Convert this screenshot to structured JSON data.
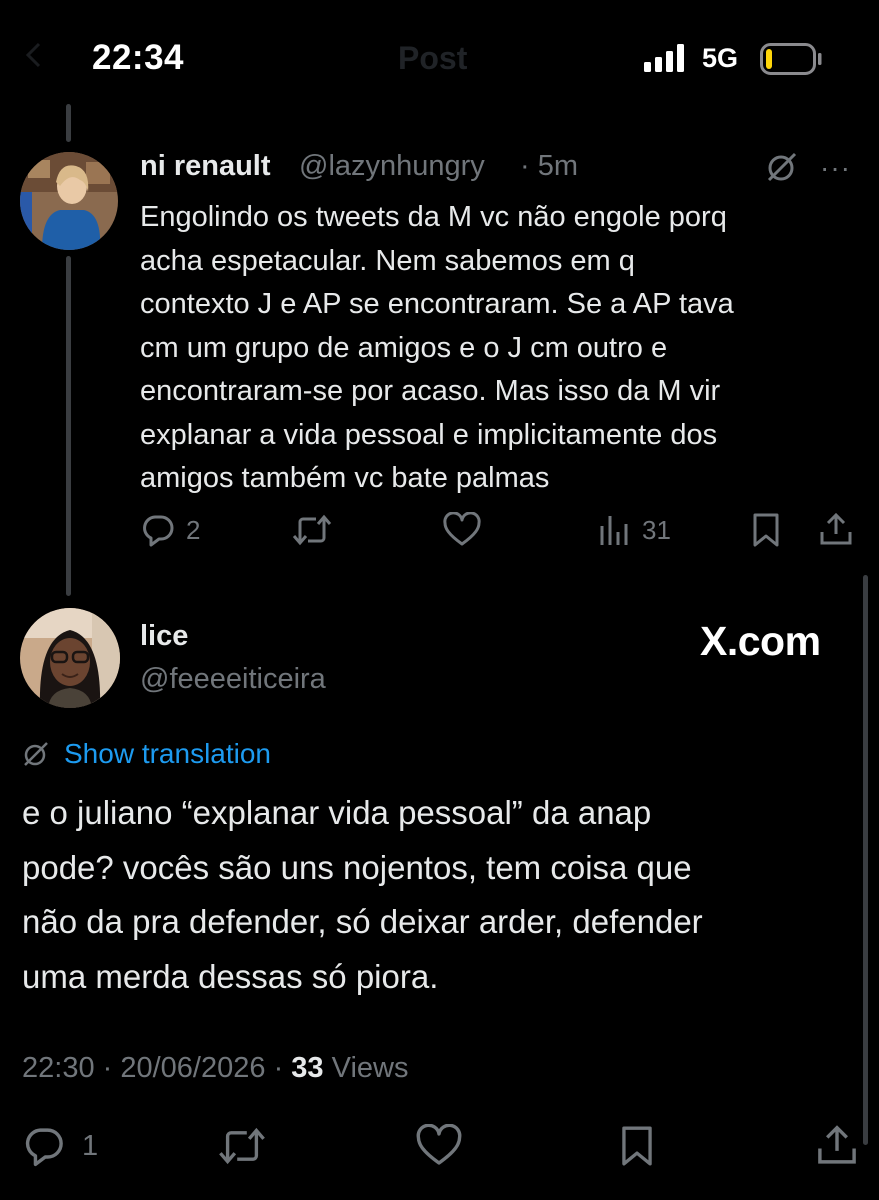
{
  "status_bar": {
    "time": "22:34",
    "network": "5G",
    "signal_bars": 4,
    "battery_level": 0.1
  },
  "header": {
    "title": "Post"
  },
  "parent_tweet": {
    "author_name": "ni renault",
    "author_handle": "@lazynhungry",
    "time": "· 5m",
    "body": "Engolindo os tweets da M vc não engole porq\nacha espetacular. Nem sabemos em q\ncontexto J e AP se encontraram. Se a AP tava\ncm um grupo de amigos e o J cm outro e\nencontraram-se por acaso. Mas isso da M vir\nexplanar a vida pessoal e implicitamente dos\namigos também vc bate palmas",
    "replies": "2",
    "views": "31",
    "more": "···"
  },
  "main_tweet": {
    "author_name": "lice",
    "author_handle": "@feeeeiticeira",
    "watermark": "X.com",
    "translate_label": "Show translation",
    "body": "e o juliano “explanar vida pessoal” da anap\npode? vocês são uns nojentos, tem coisa que\nnão da pra defender, só deixar arder, defender\numa merda dessas só piora.",
    "meta_time": "22:30",
    "meta_sep1": " · ",
    "meta_date": "20/06/2026",
    "meta_sep2": " · ",
    "views_count": "33",
    "views_label": " Views",
    "replies": "1"
  },
  "icons": [
    "back-icon",
    "signal-icon",
    "battery-icon",
    "grok-icon",
    "more-icon",
    "reply-icon",
    "retweet-icon",
    "like-icon",
    "views-icon",
    "bookmark-icon",
    "share-icon",
    "translate-icon"
  ],
  "colors": {
    "background": "#000000",
    "text": "#e7e9ea",
    "muted": "#71767b",
    "link": "#1d9bf0",
    "battery_low": "#ffd60a"
  }
}
